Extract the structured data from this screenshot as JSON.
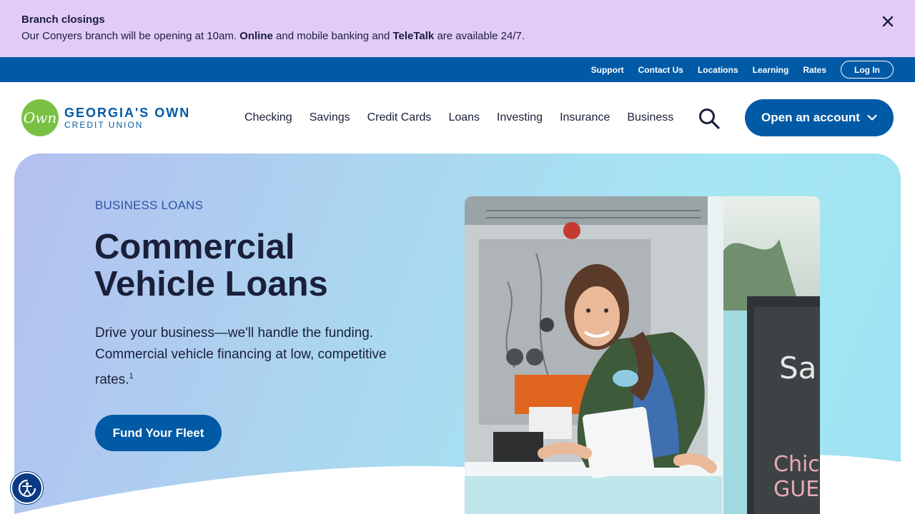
{
  "alert": {
    "title": "Branch closings",
    "message_prefix": "Our Conyers branch will be opening at 10am. ",
    "link_online": "Online",
    "message_middle": " and mobile banking and ",
    "link_teletalk": "TeleTalk",
    "message_suffix": " are available 24/7.",
    "close_icon": "close-icon",
    "bg_color": "#e3cbf8"
  },
  "utility_nav": {
    "links": [
      "Support",
      "Contact Us",
      "Locations",
      "Learning",
      "Rates"
    ],
    "login_label": "Log In",
    "bg_color": "#005aa6"
  },
  "header": {
    "logo": {
      "mark_text": "Own",
      "line1": "GEORGIA'S OWN",
      "line2": "CREDIT UNION",
      "mark_color": "#7ac143"
    },
    "nav": [
      "Checking",
      "Savings",
      "Credit Cards",
      "Loans",
      "Investing",
      "Insurance",
      "Business"
    ],
    "search_icon": "search-icon",
    "open_account_label": "Open an account",
    "open_account_icon": "chevron-down-icon"
  },
  "hero": {
    "eyebrow": "BUSINESS LOANS",
    "title": "Commercial Vehicle Loans",
    "description": "Drive your business—we'll handle the funding. Commercial vehicle financing at low, competitive rates.",
    "footnote": "1",
    "cta_label": "Fund Your Fleet",
    "image_alt": "Smiling woman leaning out of a food truck window"
  },
  "accessibility": {
    "icon": "accessibility-icon"
  },
  "colors": {
    "brand_blue": "#005aa6",
    "brand_green": "#7ac143",
    "text_dark": "#1a1f3a"
  }
}
